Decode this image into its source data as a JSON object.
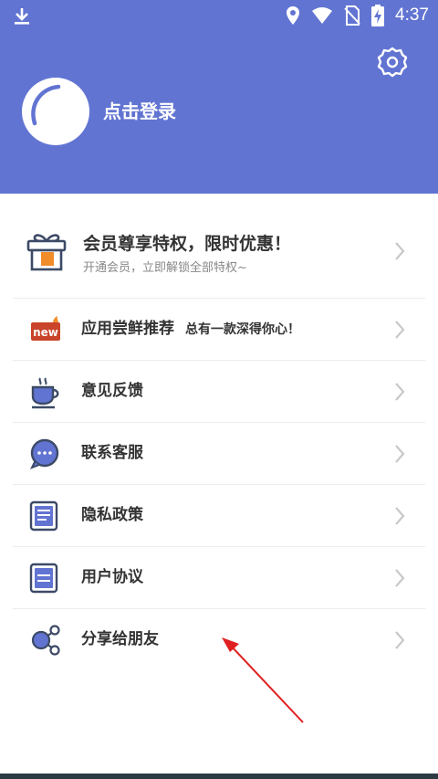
{
  "status_bar": {
    "time": "4:37"
  },
  "header": {
    "login_text": "点击登录"
  },
  "vip": {
    "title": "会员尊享特权，限时优惠！",
    "subtitle": "开通会员，立即解锁全部特权~"
  },
  "menu": {
    "items": [
      {
        "label": "应用尝鲜推荐",
        "sub": "总有一款深得你心！",
        "icon": "new-badge-icon"
      },
      {
        "label": "意见反馈",
        "icon": "coffee-cup-icon"
      },
      {
        "label": "联系客服",
        "icon": "chat-bubble-icon"
      },
      {
        "label": "隐私政策",
        "icon": "document-icon"
      },
      {
        "label": "用户协议",
        "icon": "agreement-icon"
      },
      {
        "label": "分享给朋友",
        "icon": "share-icon"
      }
    ]
  },
  "new_badge": "new",
  "colors": {
    "header": "#6274d2",
    "accent_orange": "#f08c2a",
    "badge_red": "#c9442a",
    "icon_stroke": "#3c4a66",
    "annotation_arrow": "#e02020"
  }
}
